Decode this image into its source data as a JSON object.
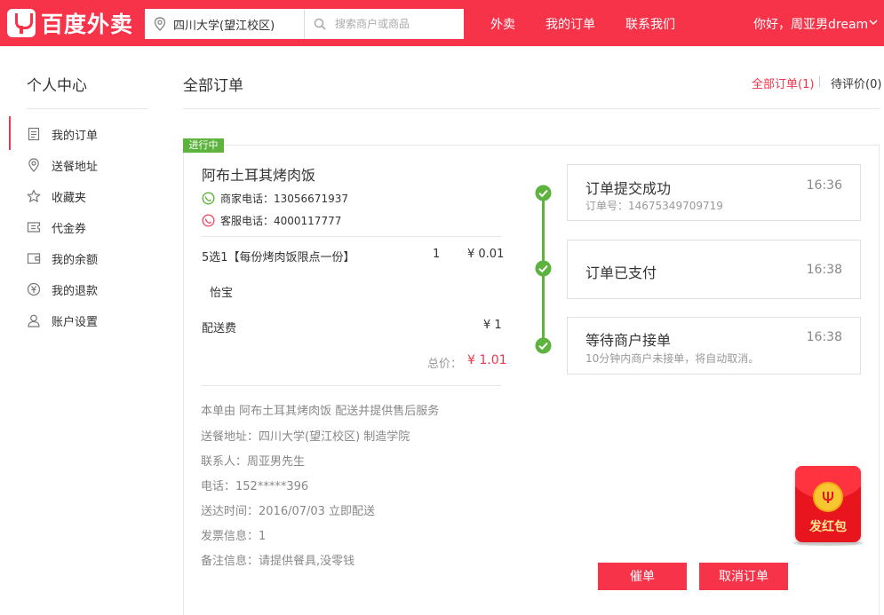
{
  "header": {
    "logo_text": "百度外卖",
    "address": "四川大学(望江校区)",
    "search_placeholder": "搜索商户或商品",
    "nav": [
      "外卖",
      "我的订单",
      "联系我们"
    ],
    "greeting": "你好，周亚男dream",
    "brand_color": "#f7334a"
  },
  "sidebar": {
    "title": "个人中心",
    "items": [
      {
        "label": "我的订单",
        "icon": "list-icon",
        "active": true
      },
      {
        "label": "送餐地址",
        "icon": "location-pin-icon"
      },
      {
        "label": "收藏夹",
        "icon": "star-icon"
      },
      {
        "label": "代金券",
        "icon": "coupon-icon"
      },
      {
        "label": "我的余额",
        "icon": "wallet-icon"
      },
      {
        "label": "我的退款",
        "icon": "yen-refund-icon"
      },
      {
        "label": "账户设置",
        "icon": "user-icon"
      }
    ]
  },
  "main": {
    "title": "全部订单",
    "tabs": [
      {
        "label": "全部订单(1)",
        "active": true
      },
      {
        "label": "待评价(0)"
      }
    ]
  },
  "order": {
    "status_badge": "进行中",
    "shop_name": "阿布土耳其烤肉饭",
    "merchant_phone": "商家电话：13056671937",
    "service_phone": "客服电话：4000117777",
    "item": {
      "name": "5选1【每份烤肉饭限点一份】",
      "qty": "1",
      "price": "¥ 0.01",
      "note": "怡宝"
    },
    "delivery_fee_label": "配送费",
    "delivery_fee": "¥ 1",
    "total_label": "总价：",
    "total": "¥ 1.01",
    "info": [
      "本单由 阿布土耳其烤肉饭 配送并提供售后服务",
      "送餐地址：四川大学(望江校区) 制造学院",
      "联系人：周亚男先生",
      "电话：152*****396",
      "送达时间：2016/07/03 立即配送",
      "发票信息：1",
      "备注信息：请提供餐具,没零钱"
    ],
    "timeline": [
      {
        "title": "订单提交成功",
        "time": "16:36",
        "sub": "订单号：14675349709719"
      },
      {
        "title": "订单已支付",
        "time": "16:38",
        "sub": ""
      },
      {
        "title": "等待商户接单",
        "time": "16:38",
        "sub": "10分钟内商户未接单，将自动取消。"
      }
    ],
    "buttons": {
      "urge": "催单",
      "cancel": "取消订单"
    },
    "status_color": "#5db33d"
  },
  "red_packet": {
    "label": "发红包"
  }
}
